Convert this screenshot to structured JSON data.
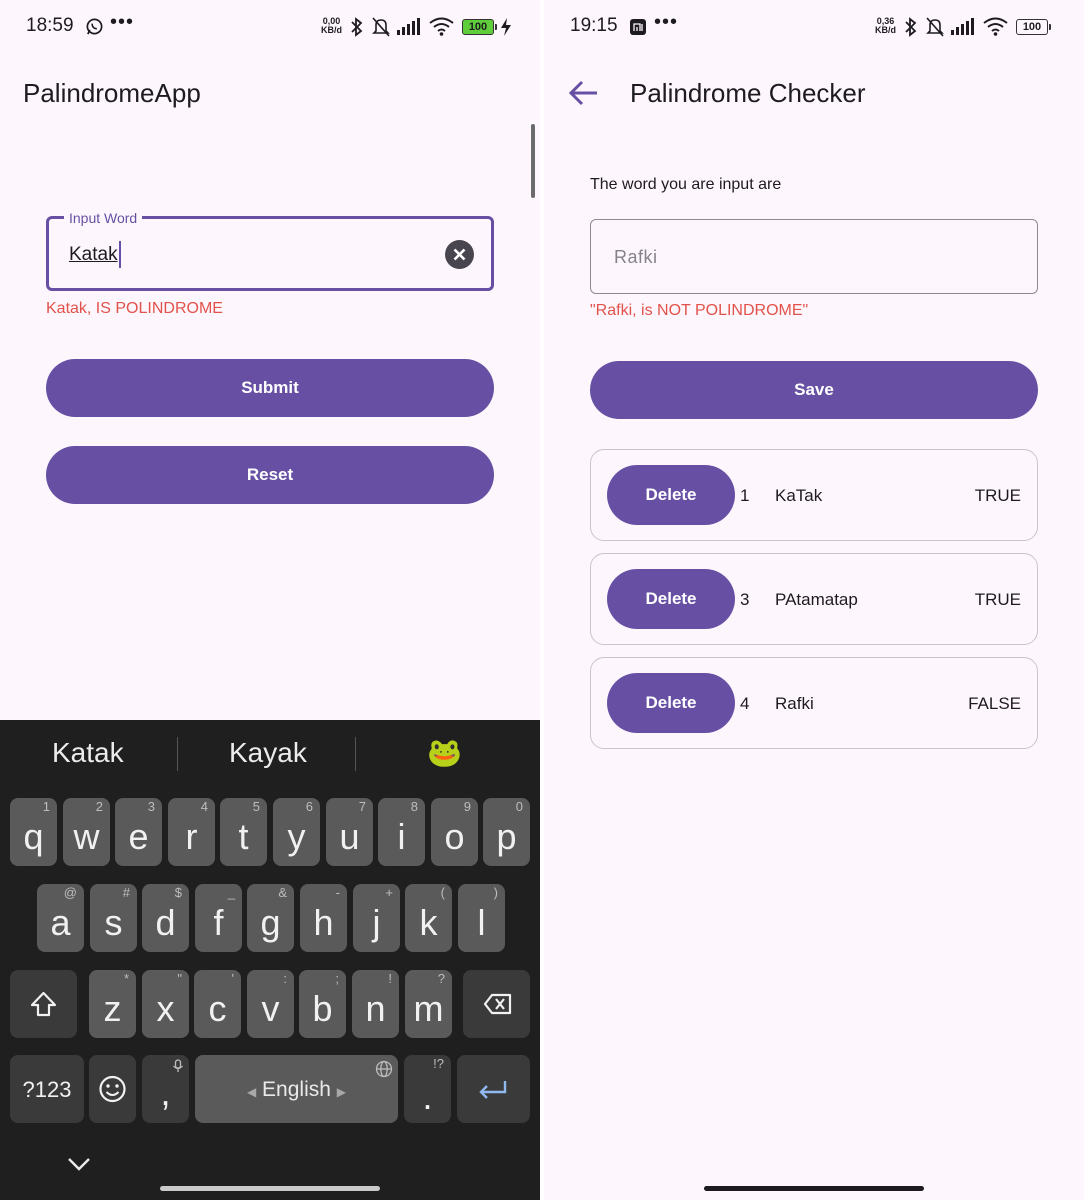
{
  "left_screen": {
    "status": {
      "time": "18:59",
      "data_rate": [
        "0,00",
        "KB/d"
      ],
      "battery": "100"
    },
    "app_title": "PalindromeApp",
    "input": {
      "label": "Input Word",
      "value": "Katak"
    },
    "result_text": "Katak, IS POLINDROME",
    "submit_label": "Submit",
    "reset_label": "Reset"
  },
  "keyboard": {
    "suggestions": [
      "Katak",
      "Kayak"
    ],
    "emoji_suggestion": "🐸",
    "row1": [
      {
        "k": "q",
        "h": "1"
      },
      {
        "k": "w",
        "h": "2"
      },
      {
        "k": "e",
        "h": "3"
      },
      {
        "k": "r",
        "h": "4"
      },
      {
        "k": "t",
        "h": "5"
      },
      {
        "k": "y",
        "h": "6"
      },
      {
        "k": "u",
        "h": "7"
      },
      {
        "k": "i",
        "h": "8"
      },
      {
        "k": "o",
        "h": "9"
      },
      {
        "k": "p",
        "h": "0"
      }
    ],
    "row2": [
      {
        "k": "a",
        "h": "@"
      },
      {
        "k": "s",
        "h": "#"
      },
      {
        "k": "d",
        "h": "$"
      },
      {
        "k": "f",
        "h": "_"
      },
      {
        "k": "g",
        "h": "&"
      },
      {
        "k": "h",
        "h": "-"
      },
      {
        "k": "j",
        "h": "+"
      },
      {
        "k": "k",
        "h": "("
      },
      {
        "k": "l",
        "h": ")"
      }
    ],
    "row3": [
      {
        "k": "z",
        "h": "*"
      },
      {
        "k": "x",
        "h": "\""
      },
      {
        "k": "c",
        "h": "'"
      },
      {
        "k": "v",
        "h": ":"
      },
      {
        "k": "b",
        "h": ";"
      },
      {
        "k": "n",
        "h": "!"
      },
      {
        "k": "m",
        "h": "?"
      }
    ],
    "symbols_label": "?123",
    "comma": ",",
    "period": ".",
    "period_hint": "!?",
    "space_label": "English"
  },
  "right_screen": {
    "status": {
      "time": "19:15",
      "data_rate": [
        "0,36",
        "KB/d"
      ],
      "battery": "100"
    },
    "title": "Palindrome Checker",
    "prompt": "The word you are input are",
    "input_value": "Rafki",
    "result_text": "\"Rafki, is NOT POLINDROME\"",
    "save_label": "Save",
    "items": [
      {
        "delete_label": "Delete",
        "id": "1",
        "word": "KaTak",
        "result": "TRUE"
      },
      {
        "delete_label": "Delete",
        "id": "3",
        "word": "PAtamatap",
        "result": "TRUE"
      },
      {
        "delete_label": "Delete",
        "id": "4",
        "word": "Rafki",
        "result": "FALSE"
      }
    ]
  },
  "colors": {
    "primary": "#6750a4",
    "error": "#e2524b",
    "background": "#fdf7fd",
    "keyboard": "#1f1f1f"
  }
}
